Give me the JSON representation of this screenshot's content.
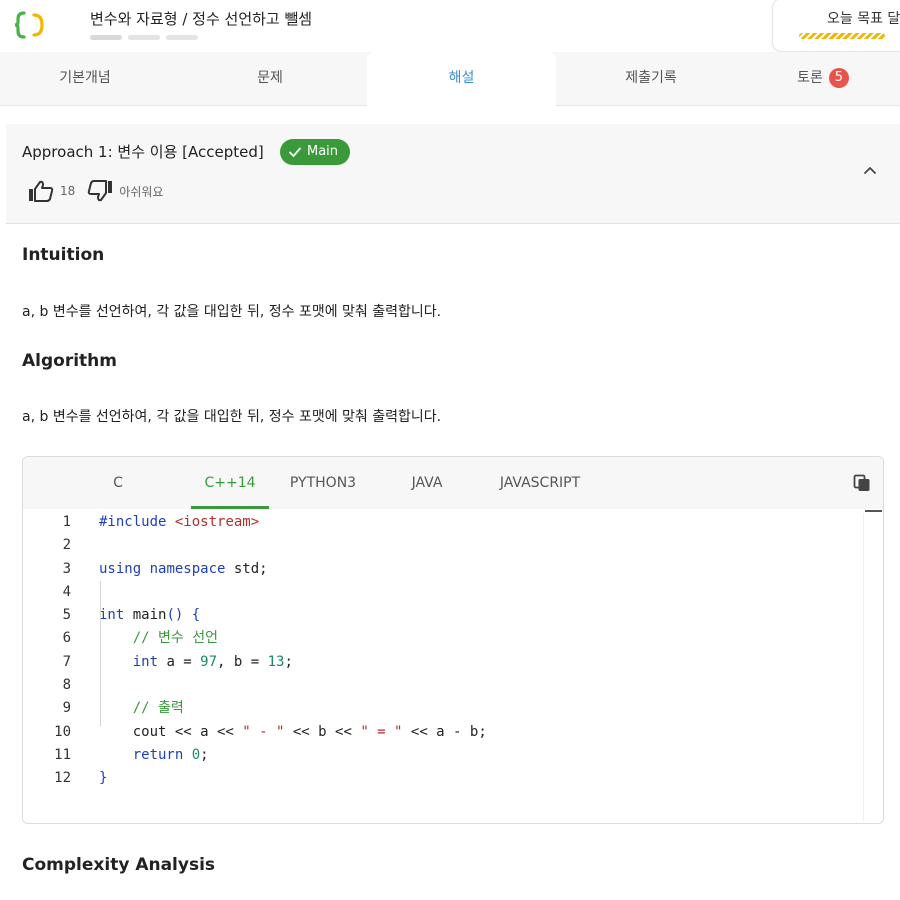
{
  "header": {
    "course_title": "변수와 자료형 / 정수 선언하고 뺄셈",
    "goal_label": "오늘 목표 달"
  },
  "tabs": [
    {
      "label": "기본개념"
    },
    {
      "label": "문제"
    },
    {
      "label": "해설",
      "active": true
    },
    {
      "label": "제출기록"
    },
    {
      "label": "토론",
      "badge": "5"
    }
  ],
  "approach": {
    "title": "Approach 1: 변수 이용 [Accepted]",
    "badge": "Main",
    "likes": "18",
    "dislike_label": "아쉬워요"
  },
  "content": {
    "intuition_heading": "Intuition",
    "intuition_text": "a, b 변수를 선언하여, 각 값을 대입한 뒤, 정수 포맷에 맞춰 출력합니다.",
    "algorithm_heading": "Algorithm",
    "algorithm_text": "a, b 변수를 선언하여, 각 값을 대입한 뒤, 정수 포맷에 맞춰 출력합니다.",
    "complexity_heading": "Complexity Analysis"
  },
  "code": {
    "languages": [
      "C",
      "C++14",
      "PYTHON3",
      "JAVA",
      "JAVASCRIPT"
    ],
    "active_language": "C++14",
    "line_numbers": [
      "1",
      "2",
      "3",
      "4",
      "5",
      "6",
      "7",
      "8",
      "9",
      "10",
      "11",
      "12"
    ]
  },
  "colors": {
    "accent_blue": "#3b8ed6",
    "accent_green": "#3a9a3a",
    "badge_red": "#e8534a"
  }
}
